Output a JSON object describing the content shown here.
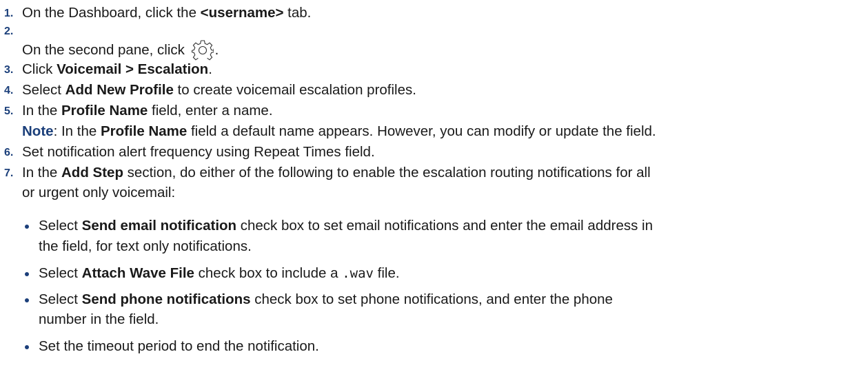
{
  "steps": [
    {
      "num": "1.",
      "pre": "On the Dashboard, click the ",
      "bold": "<username>",
      "post": " tab."
    },
    {
      "num": "2.",
      "pre": "On the second pane, click ",
      "icon": "gear-icon",
      "post": "."
    },
    {
      "num": "3.",
      "pre": "Click ",
      "bold": "Voicemail > Escalation",
      "post": "."
    },
    {
      "num": "4.",
      "pre": "Select ",
      "bold": "Add New Profile",
      "post": " to create voicemail escalation profiles."
    },
    {
      "num": "5.",
      "pre": "In the ",
      "bold": "Profile Name",
      "post": " field, enter a name.",
      "note": {
        "label": "Note",
        "pre": ": In the ",
        "bold": "Profile Name",
        "post": " field a default name appears. However, you can modify or update the field."
      }
    },
    {
      "num": "6.",
      "pre": "Set notification alert frequency using Repeat Times field."
    },
    {
      "num": "7.",
      "pre": "In the ",
      "bold": "Add Step",
      "post": " section, do either of the following to enable the escalation routing notifications for all",
      "line2": "or urgent only voicemail:"
    }
  ],
  "bullets": [
    {
      "pre": "Select ",
      "bold": "Send email notification",
      "post": " check box to set email notifications and enter the email address in",
      "line2": "the field, for text only notifications."
    },
    {
      "pre": "Select ",
      "bold": "Attach Wave File",
      "post": " check box to include a ",
      "code": ".wav",
      "post2": " file."
    },
    {
      "pre": "Select ",
      "bold": "Send phone notifications",
      "post": " check box to set phone notifications, and enter the phone",
      "line2": "number in the field."
    },
    {
      "pre": "Set the timeout period to end the notification."
    }
  ]
}
